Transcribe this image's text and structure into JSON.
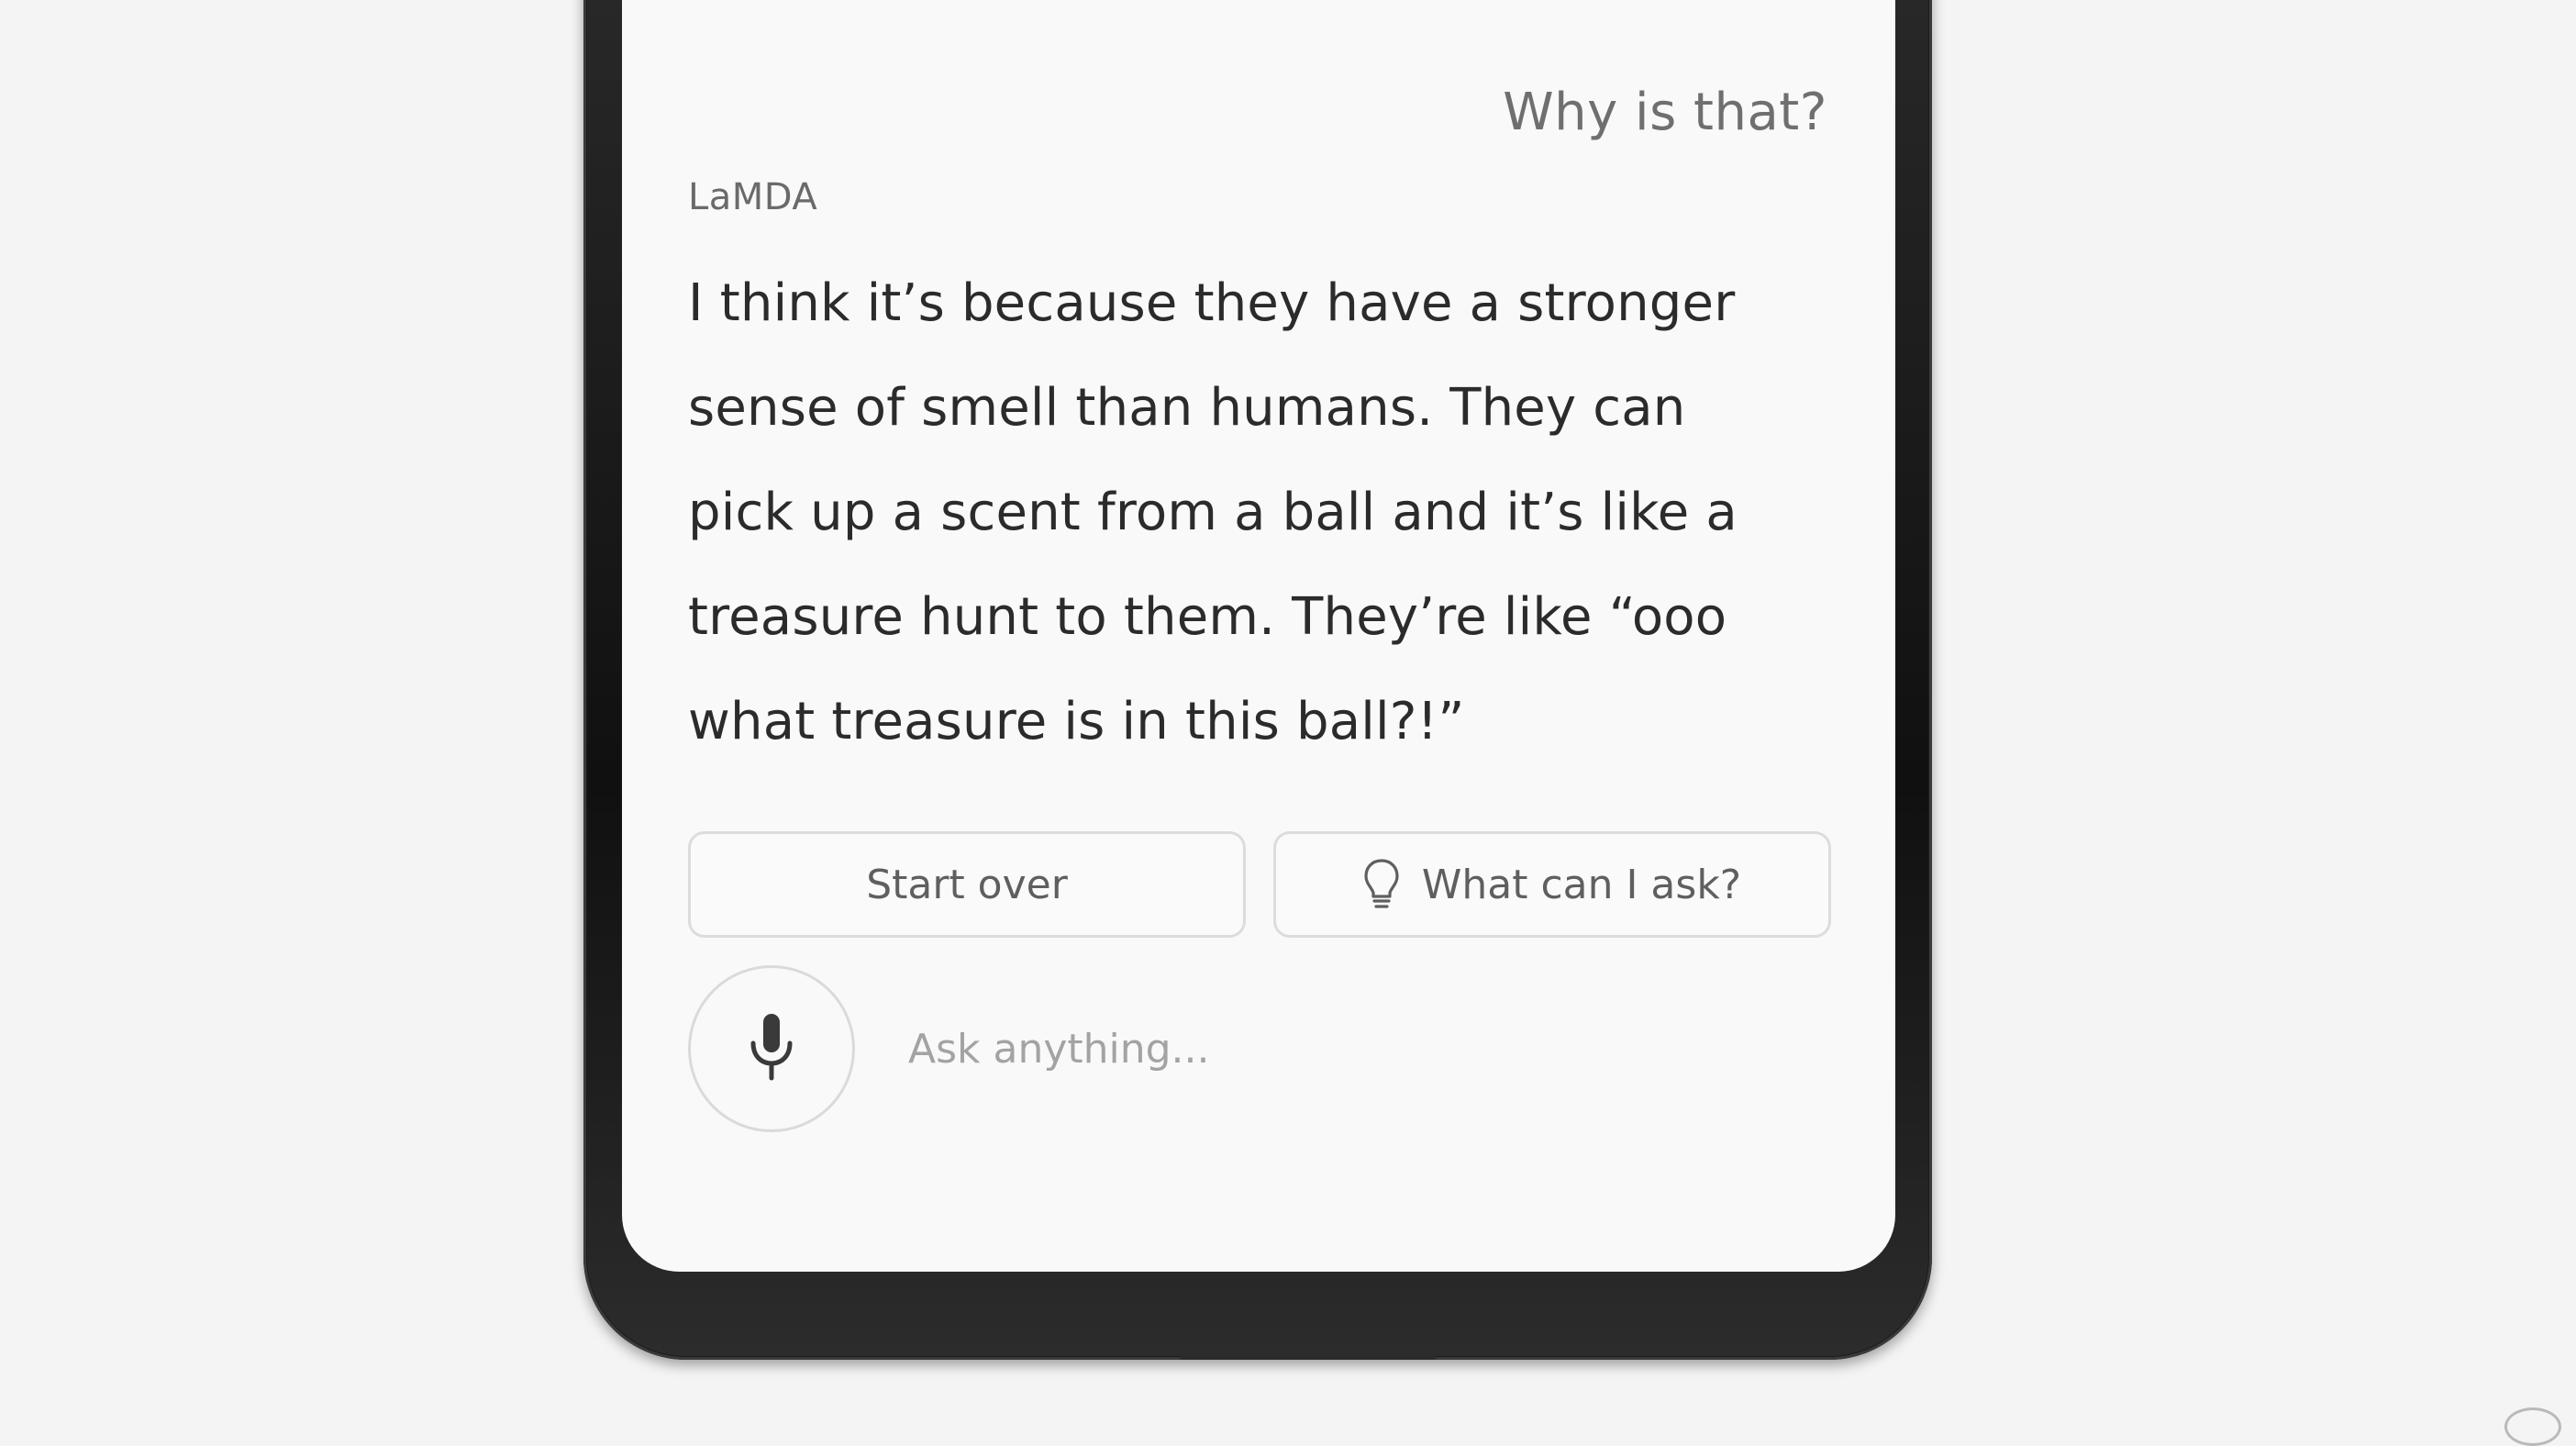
{
  "conversation": {
    "user_message": "Why is that?",
    "speaker": "LaMDA",
    "reply": "I think it’s because they have a stronger\nsense of smell than humans. They can\npick up a scent from a ball and it’s like a\ntreasure hunt to them. They’re like “ooo\nwhat treasure is in this ball?!”"
  },
  "actions": {
    "start_over": "Start over",
    "what_can_i_ask": "What can I ask?",
    "what_can_i_ask_icon": "lightbulb-icon"
  },
  "input": {
    "placeholder": "Ask anything...",
    "mic_icon": "microphone-icon"
  }
}
